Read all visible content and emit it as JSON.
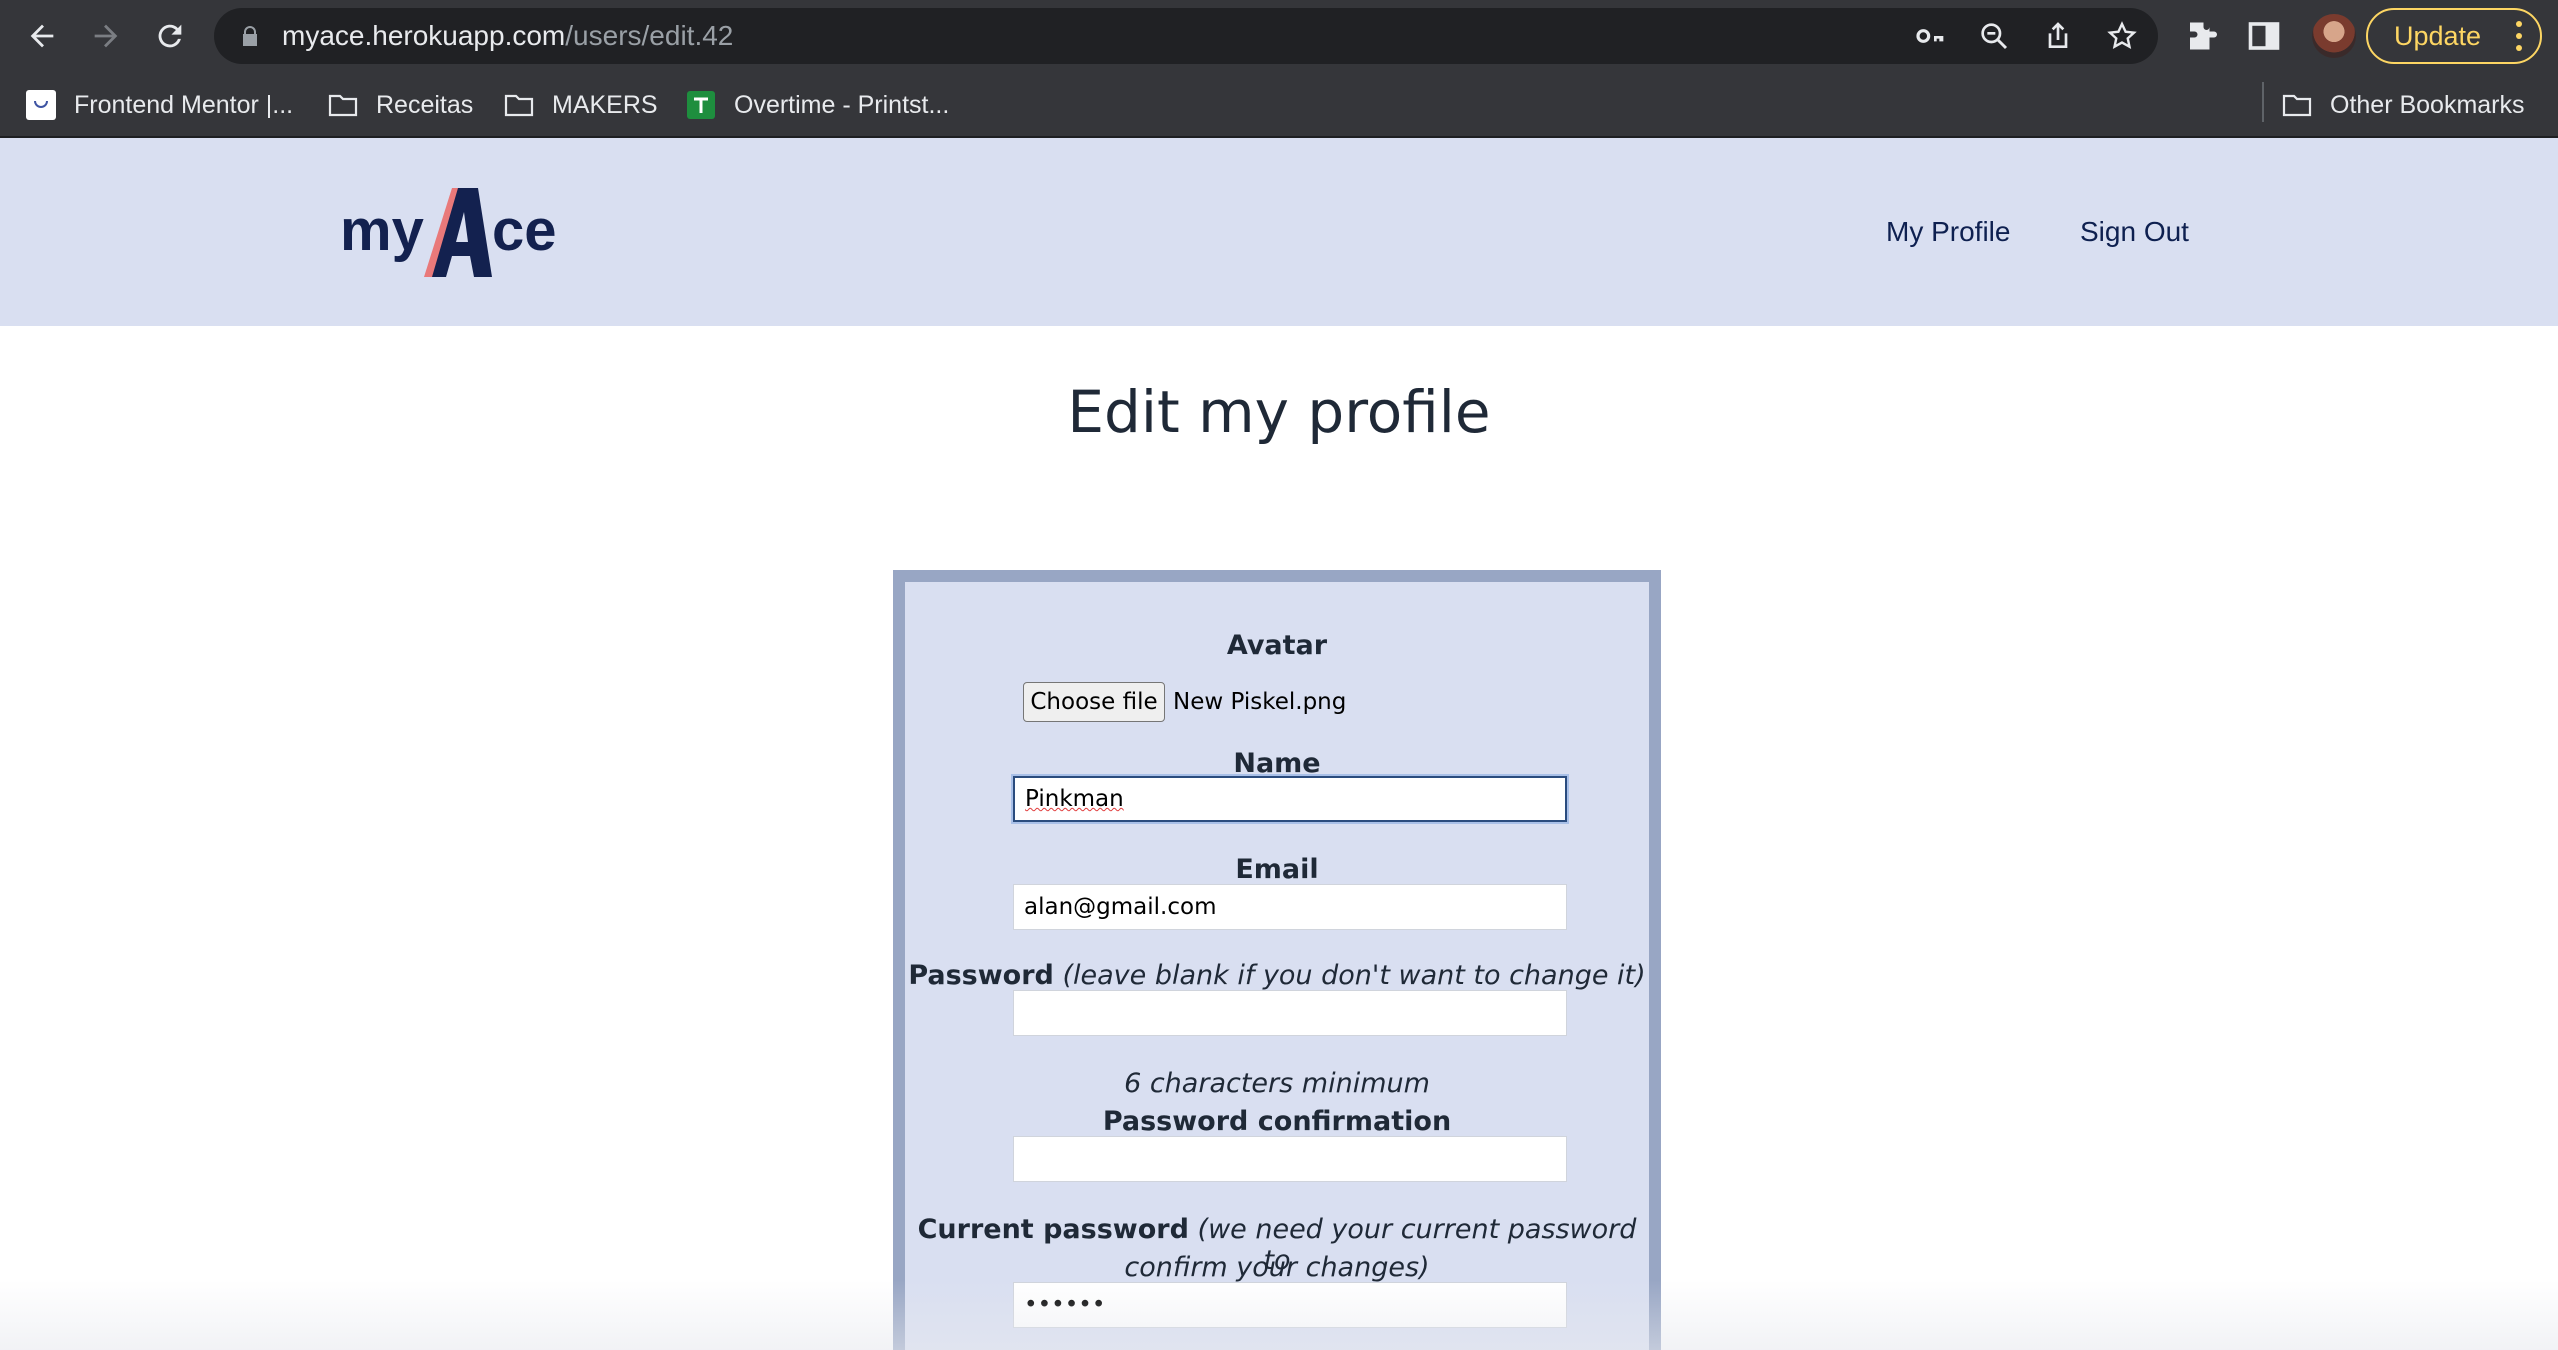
{
  "browser": {
    "url_host": "myace.herokuapp.com",
    "url_path": "/users/edit.42",
    "update_label": "Update",
    "bookmarks": [
      {
        "label": "Frontend Mentor |...",
        "icon": "frontend-mentor-icon"
      },
      {
        "label": "Receitas",
        "icon": "folder-icon"
      },
      {
        "label": "MAKERS",
        "icon": "folder-icon"
      },
      {
        "label": "Overtime - Printst...",
        "icon": "sheets-icon"
      }
    ],
    "other_bookmarks": "Other Bookmarks"
  },
  "header": {
    "logo_text": "myAce",
    "nav": [
      {
        "label": "My Profile"
      },
      {
        "label": "Sign Out"
      }
    ]
  },
  "page": {
    "title": "Edit my profile"
  },
  "form": {
    "avatar_label": "Avatar",
    "choose_file_label": "Choose file",
    "file_name": "New Piskel.png",
    "name_label": "Name",
    "name_value": "Pinkman",
    "email_label": "Email",
    "email_value": "alan@gmail.com",
    "password_label": "Password",
    "password_hint": "(leave blank if you don't want to change it)",
    "password_value": "",
    "password_min": "6 characters minimum",
    "password_confirmation_label": "Password confirmation",
    "password_confirmation_value": "",
    "current_password_label": "Current password",
    "current_password_hint_1": "(we need your current password to",
    "current_password_hint_2": "confirm your changes)",
    "current_password_value": "••••••"
  },
  "colors": {
    "header_bg": "#d9dff1",
    "card_border": "#98a6c4",
    "nav_text": "#0e2050",
    "logo_navy": "#13214f",
    "logo_accent": "#e9797a"
  }
}
